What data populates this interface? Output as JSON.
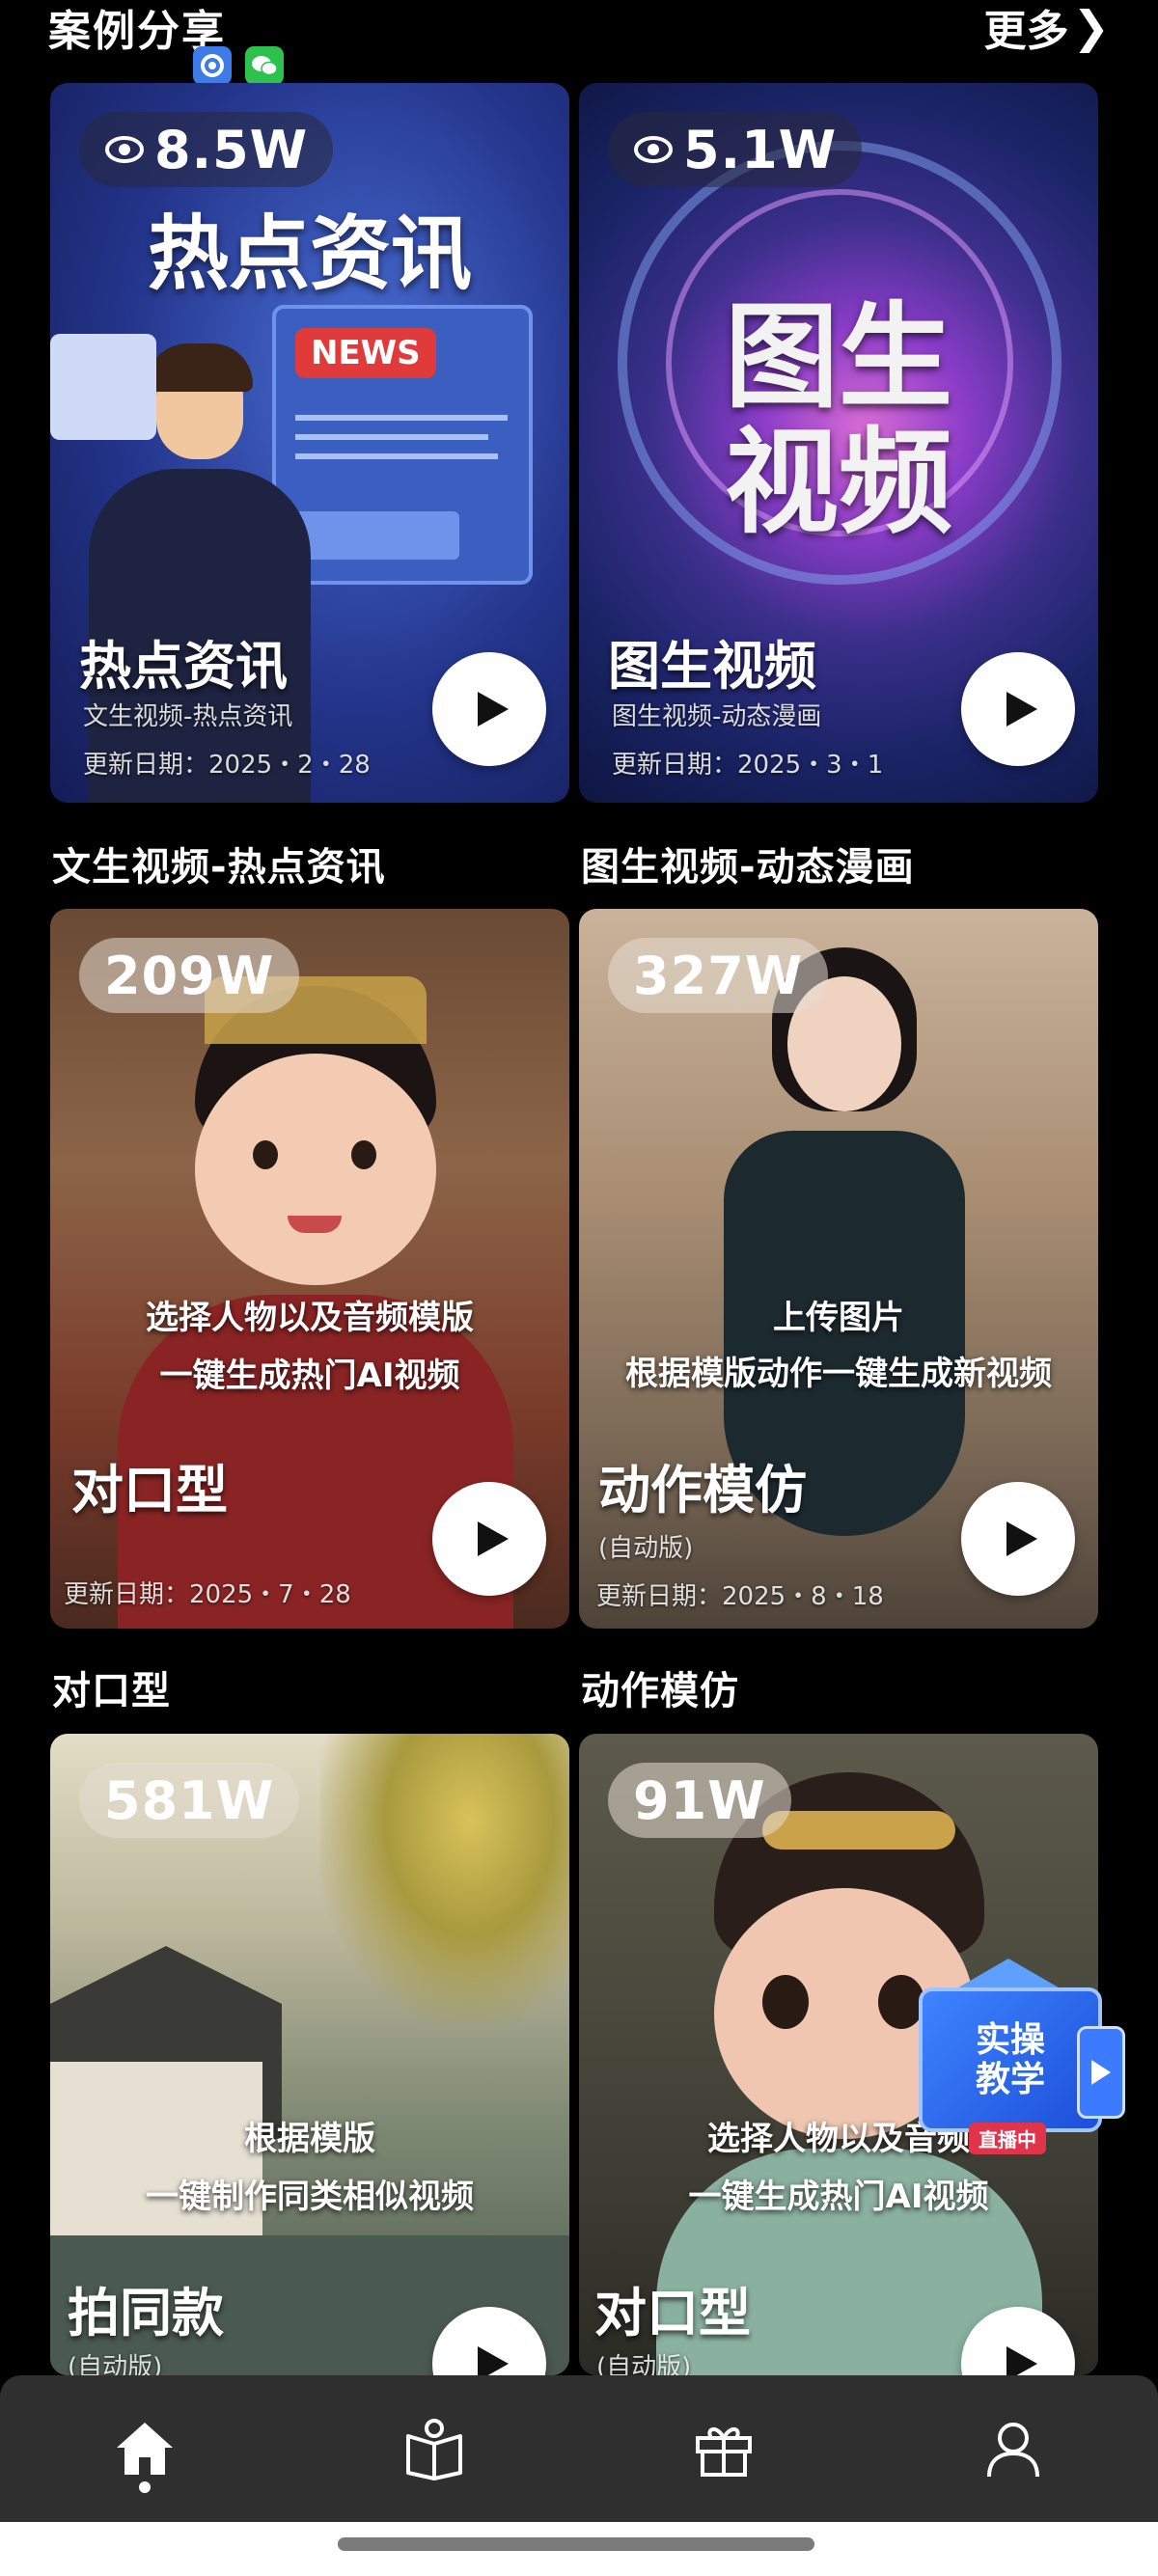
{
  "header": {
    "title": "案例分享",
    "more_label": "更多",
    "more_chevron": "❯"
  },
  "cards": [
    {
      "views": "8.5W",
      "headline": "热点资讯",
      "title": "热点资讯",
      "subtitle": "文生视频-热点资讯",
      "date": "更新日期：2025・2・28",
      "caption": "文生视频-热点资讯",
      "news_label": "NEWS"
    },
    {
      "views": "5.1W",
      "headline_line1": "图生",
      "headline_line2": "视频",
      "title": "图生视频",
      "subtitle": "图生视频-动态漫画",
      "date": "更新日期：2025・3・1",
      "caption": "图生视频-动态漫画"
    },
    {
      "views": "209W",
      "overlay_line1": "选择人物以及音频模版",
      "overlay_line2": "一键生成热门AI视频",
      "title": "对口型",
      "date": "更新日期：2025・7・28",
      "caption": "对口型"
    },
    {
      "views": "327W",
      "overlay_line1": "上传图片",
      "overlay_line2": "根据模版动作一键生成新视频",
      "title": "动作模仿",
      "subtitle": "(自动版)",
      "date": "更新日期：2025・8・18",
      "caption": "动作模仿"
    },
    {
      "views": "581W",
      "overlay_line1": "根据模版",
      "overlay_line2": "一键制作同类相似视频",
      "title": "拍同款",
      "subtitle": "(自动版)"
    },
    {
      "views": "91W",
      "overlay_line1": "选择人物以及音频",
      "overlay_line2": "一键生成热门AI视频",
      "title": "对口型",
      "subtitle": "(自动版)"
    }
  ],
  "floating_badge": {
    "line1": "实操",
    "line2": "教学",
    "tag": "直播中"
  },
  "nav": {
    "items": [
      "home-icon",
      "book-icon",
      "gift-icon",
      "profile-icon"
    ],
    "active_index": 0
  },
  "colors": {
    "background": "#000000",
    "nav_background": "#2f2f2f",
    "accent_blue": "#3c7be8"
  }
}
